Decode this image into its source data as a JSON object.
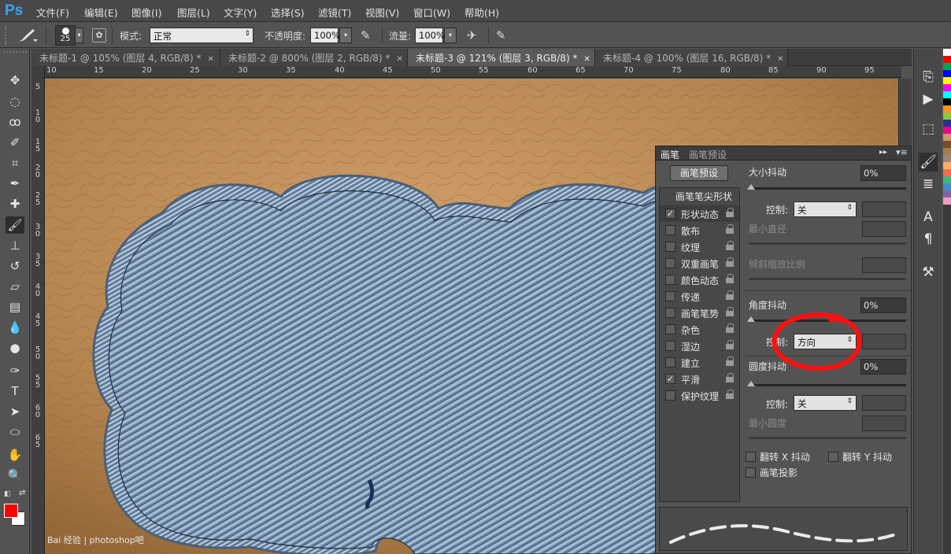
{
  "app": {
    "logo": "Ps"
  },
  "menu": [
    "文件(F)",
    "编辑(E)",
    "图像(I)",
    "图层(L)",
    "文字(Y)",
    "选择(S)",
    "滤镜(T)",
    "视图(V)",
    "窗口(W)",
    "帮助(H)"
  ],
  "options_bar": {
    "brush_size": "25",
    "mode_label": "模式:",
    "mode_value": "正常",
    "opacity_label": "不透明度:",
    "opacity_value": "100%",
    "flow_label": "流量:",
    "flow_value": "100%"
  },
  "doc_tabs": [
    {
      "title": "未标题-1 @ 105% (图层 4, RGB/8) *",
      "active": false
    },
    {
      "title": "未标题-2 @ 800% (图层 2, RGB/8) *",
      "active": false
    },
    {
      "title": "未标题-3 @ 121% (图层 3, RGB/8) *",
      "active": true
    },
    {
      "title": "未标题-4 @ 100% (图层 16, RGB/8) *",
      "active": false
    }
  ],
  "ruler": {
    "top_ticks": [
      "10",
      "15",
      "20",
      "25",
      "30",
      "35",
      "40",
      "45",
      "50",
      "55",
      "60",
      "65",
      "70",
      "75",
      "80",
      "85",
      "90",
      "95"
    ],
    "left_ticks": [
      "5",
      "10",
      "15",
      "20",
      "25",
      "30",
      "35",
      "40",
      "45",
      "50",
      "55",
      "60",
      "65"
    ]
  },
  "brush_panel": {
    "tabs": [
      "画笔",
      "画笔预设"
    ],
    "presets_button": "画笔预设",
    "tip_shape": "画笔笔尖形状",
    "options": [
      {
        "label": "形状动态",
        "checked": true
      },
      {
        "label": "散布",
        "checked": false
      },
      {
        "label": "纹理",
        "checked": false
      },
      {
        "label": "双重画笔",
        "checked": false
      },
      {
        "label": "颜色动态",
        "checked": false
      },
      {
        "label": "传递",
        "checked": false
      },
      {
        "label": "画笔笔势",
        "checked": false
      },
      {
        "label": "杂色",
        "checked": false
      },
      {
        "label": "湿边",
        "checked": false
      },
      {
        "label": "建立",
        "checked": false
      },
      {
        "label": "平滑",
        "checked": true
      },
      {
        "label": "保护纹理",
        "checked": false
      }
    ],
    "size_jitter_label": "大小抖动",
    "size_jitter_value": "0%",
    "control_label": "控制:",
    "size_control": "关",
    "min_diameter_label": "最小直径",
    "tilt_scale_label": "倾斜缩放比例",
    "angle_jitter_label": "角度抖动",
    "angle_jitter_value": "0%",
    "angle_control": "方向",
    "roundness_jitter_label": "圆度抖动",
    "roundness_jitter_value": "0%",
    "roundness_control": "关",
    "min_roundness_label": "最小圆度",
    "flip_x_label": "翻转 X 抖动",
    "flip_y_label": "翻转 Y 抖动",
    "brush_projection_label": "画笔投影"
  },
  "colors": {
    "foreground": "#ff0000",
    "background": "#ffffff",
    "annotation": "#ff1010"
  },
  "watermark": "Bai 经验 | photoshop吧"
}
